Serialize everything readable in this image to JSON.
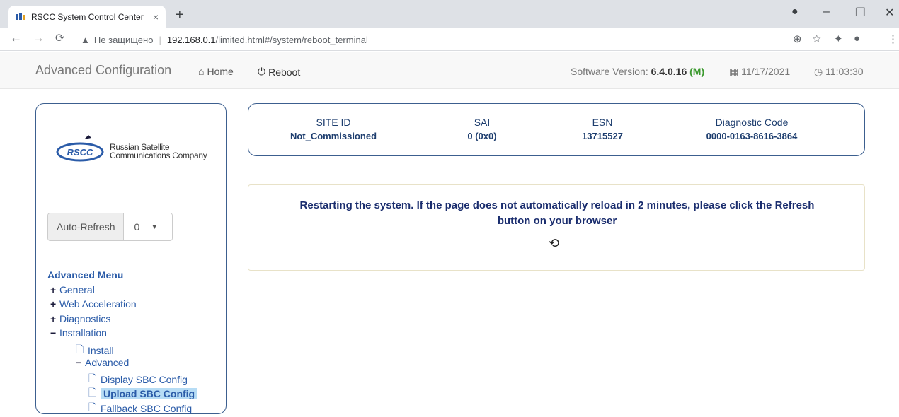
{
  "browser": {
    "tab_title": "RSCC System Control Center",
    "tab_close": "×",
    "new_tab": "+",
    "insecure_label": "Не защищено",
    "url_host": "192.168.0.1",
    "url_path": "/limited.html#/system/reboot_terminal"
  },
  "navbar": {
    "brand": "Advanced Configuration",
    "home_label": "Home",
    "reboot_label": "Reboot",
    "software_version_label": "Software Version:",
    "software_version": "6.4.0.16",
    "software_version_flag": "(M)",
    "date": "11/17/2021",
    "time": "11:03:30"
  },
  "sidebar": {
    "logo_line1": "Russian Satellite",
    "logo_line2": "Communications Company",
    "logo_abbr": "RSCC",
    "auto_refresh_label": "Auto-Refresh",
    "auto_refresh_value": "0",
    "menu_title": "Advanced Menu",
    "items": [
      {
        "label": "General",
        "type": "plus"
      },
      {
        "label": "Web Acceleration",
        "type": "plus"
      },
      {
        "label": "Diagnostics",
        "type": "plus"
      },
      {
        "label": "Installation",
        "type": "minus"
      },
      {
        "label": "Install",
        "type": "doc"
      },
      {
        "label": "Advanced",
        "type": "minus"
      },
      {
        "label": "Display SBC Config",
        "type": "doc"
      },
      {
        "label": "Upload SBC Config",
        "type": "doc",
        "active": true
      },
      {
        "label": "Fallback SBC Config",
        "type": "doc"
      }
    ]
  },
  "info": {
    "site_id_label": "SITE ID",
    "site_id": "Not_Commissioned",
    "sai_label": "SAI",
    "sai": "0 (0x0)",
    "esn_label": "ESN",
    "esn": "13715527",
    "diag_label": "Diagnostic Code",
    "diag": "0000-0163-8616-3864"
  },
  "message": {
    "line1": "Restarting the system. If the page does not automatically reload in 2 minutes, please click the Refresh",
    "line2": "button on your browser"
  },
  "colors": {
    "link_blue": "#2a5ba8",
    "panel_border": "#3c5f8f",
    "active_bg": "#b6dcf5",
    "version_flag": "#3c9a2f"
  }
}
